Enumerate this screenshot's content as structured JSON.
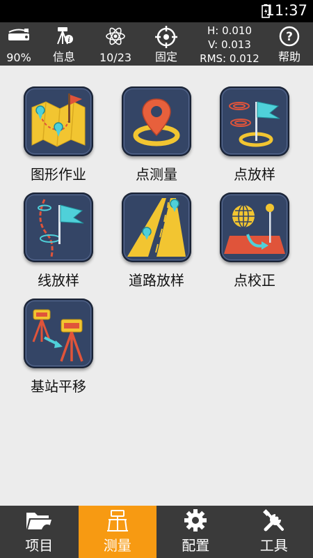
{
  "status_bar": {
    "time": "11:37",
    "icons": [
      "battery-charging-icon"
    ]
  },
  "toolbar": {
    "battery": {
      "icon": "receiver-battery-icon",
      "label": "90%"
    },
    "info": {
      "icon": "gps-info-icon",
      "label": "信息"
    },
    "satellites": {
      "icon": "satellite-atom-icon",
      "label": "10/23"
    },
    "solution": {
      "icon": "crosshair-icon",
      "label": "固定"
    },
    "precision": {
      "h": "H: 0.010",
      "v": "V: 0.013",
      "rms": "RMS: 0.012"
    },
    "help": {
      "icon": "help-icon",
      "label": "帮助"
    }
  },
  "tiles": [
    {
      "label": "图形作业",
      "icon": "map-pins-flag-icon"
    },
    {
      "label": "点测量",
      "icon": "location-pin-ring-icon"
    },
    {
      "label": "点放样",
      "icon": "flag-rings-icon"
    },
    {
      "label": "线放样",
      "icon": "curve-flag-icon"
    },
    {
      "label": "道路放样",
      "icon": "road-pins-icon"
    },
    {
      "label": "点校正",
      "icon": "globe-plane-icon"
    },
    {
      "label": "基站平移",
      "icon": "base-station-move-icon"
    }
  ],
  "bottom_nav": [
    {
      "label": "项目",
      "icon": "project-folder-icon",
      "active": false
    },
    {
      "label": "测量",
      "icon": "survey-icon",
      "active": true
    },
    {
      "label": "配置",
      "icon": "gear-icon",
      "active": false
    },
    {
      "label": "工具",
      "icon": "tools-icon",
      "active": false
    }
  ],
  "colors": {
    "toolbar": "#3a3a3a",
    "active_tab": "#f79a12",
    "tile_bg": "#344566",
    "page_bg": "#ececec"
  }
}
